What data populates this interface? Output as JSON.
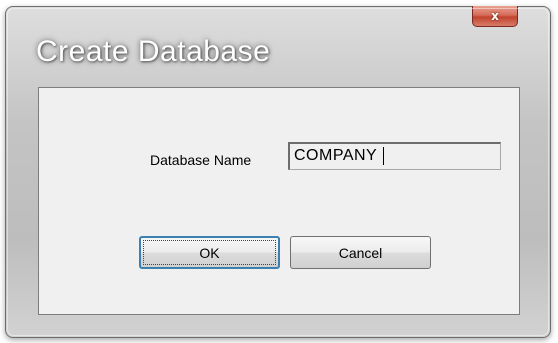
{
  "dialog": {
    "title": "Create Database",
    "close_label": "x"
  },
  "form": {
    "database_name_label": "Database Name",
    "database_name_value": "COMPANY"
  },
  "buttons": {
    "ok_label": "OK",
    "cancel_label": "Cancel"
  }
}
